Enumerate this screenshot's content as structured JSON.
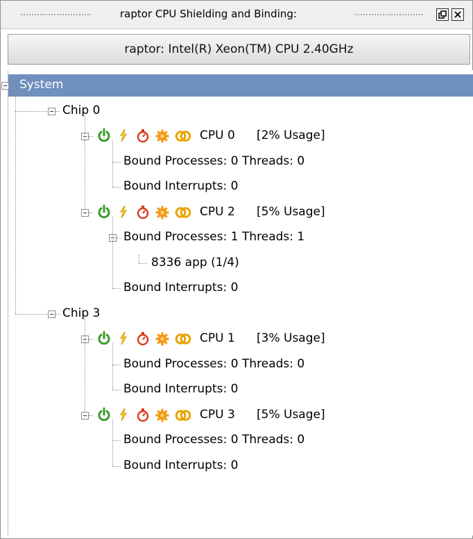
{
  "window": {
    "title": "raptor CPU Shielding and Binding:",
    "restore_icon": "restore-window-icon",
    "close_icon": "close-window-icon"
  },
  "header": {
    "label": "raptor:  Intel(R) Xeon(TM) CPU 2.40GHz"
  },
  "tree": {
    "root": {
      "label": "System",
      "selected": true
    },
    "chips": [
      {
        "label": "Chip 0",
        "cpus": [
          {
            "name": "CPU 0",
            "usage": "[2% Usage]",
            "icons": [
              "power-icon",
              "lightning-icon",
              "timer-icon",
              "gear-icon",
              "binding-rings-icon"
            ],
            "bound_processes": "Bound Processes: 0 Threads: 0",
            "processes": [],
            "bound_interrupts": "Bound Interrupts: 0"
          },
          {
            "name": "CPU 2",
            "usage": "[5% Usage]",
            "icons": [
              "power-icon",
              "lightning-icon",
              "timer-icon",
              "gear-icon",
              "binding-rings-icon"
            ],
            "bound_processes": "Bound Processes: 1 Threads: 1",
            "processes": [
              "8336 app (1/4)"
            ],
            "bound_interrupts": "Bound Interrupts: 0"
          }
        ]
      },
      {
        "label": "Chip 3",
        "cpus": [
          {
            "name": "CPU 1",
            "usage": "[3% Usage]",
            "icons": [
              "power-icon",
              "lightning-icon",
              "timer-icon",
              "gear-icon",
              "binding-rings-icon"
            ],
            "bound_processes": "Bound Processes: 0 Threads: 0",
            "processes": [],
            "bound_interrupts": "Bound Interrupts: 0"
          },
          {
            "name": "CPU 3",
            "usage": "[5% Usage]",
            "icons": [
              "power-icon",
              "lightning-icon",
              "timer-icon",
              "gear-icon",
              "binding-rings-icon"
            ],
            "bound_processes": "Bound Processes: 0 Threads: 0",
            "processes": [],
            "bound_interrupts": "Bound Interrupts: 0"
          }
        ]
      }
    ]
  },
  "colors": {
    "selection": "#6f8fbd",
    "power": "#3a9b2a",
    "lightning": "#d9a400",
    "timer": "#d83a1a",
    "gear": "#f29a1a",
    "rings": "#e9a400"
  }
}
